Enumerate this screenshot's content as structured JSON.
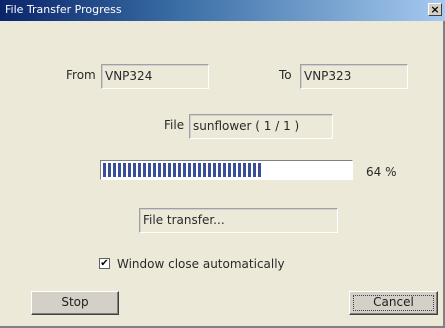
{
  "window": {
    "title": "File Transfer Progress",
    "close_glyph": "×"
  },
  "transfer": {
    "from_label": "From",
    "from_value": "VNP324",
    "to_label": "To",
    "to_value": "VNP323",
    "file_label": "File",
    "file_value": "sunflower ( 1 / 1 )",
    "progress_fraction": 0.64,
    "progress_text": "64 %",
    "status_text": "File transfer..."
  },
  "options": {
    "auto_close_label": "Window close automatically",
    "auto_close_checked": true,
    "check_glyph": "✔"
  },
  "buttons": {
    "stop_label": "Stop",
    "cancel_label": "Cancel"
  },
  "colors": {
    "titlebar_start": "#0a246a",
    "titlebar_end": "#a6caf0",
    "progress_block": "#3a4f9a",
    "dialog_bg": "#ece9d8"
  },
  "icons": {
    "close": "close-icon",
    "check": "checkmark-icon"
  }
}
